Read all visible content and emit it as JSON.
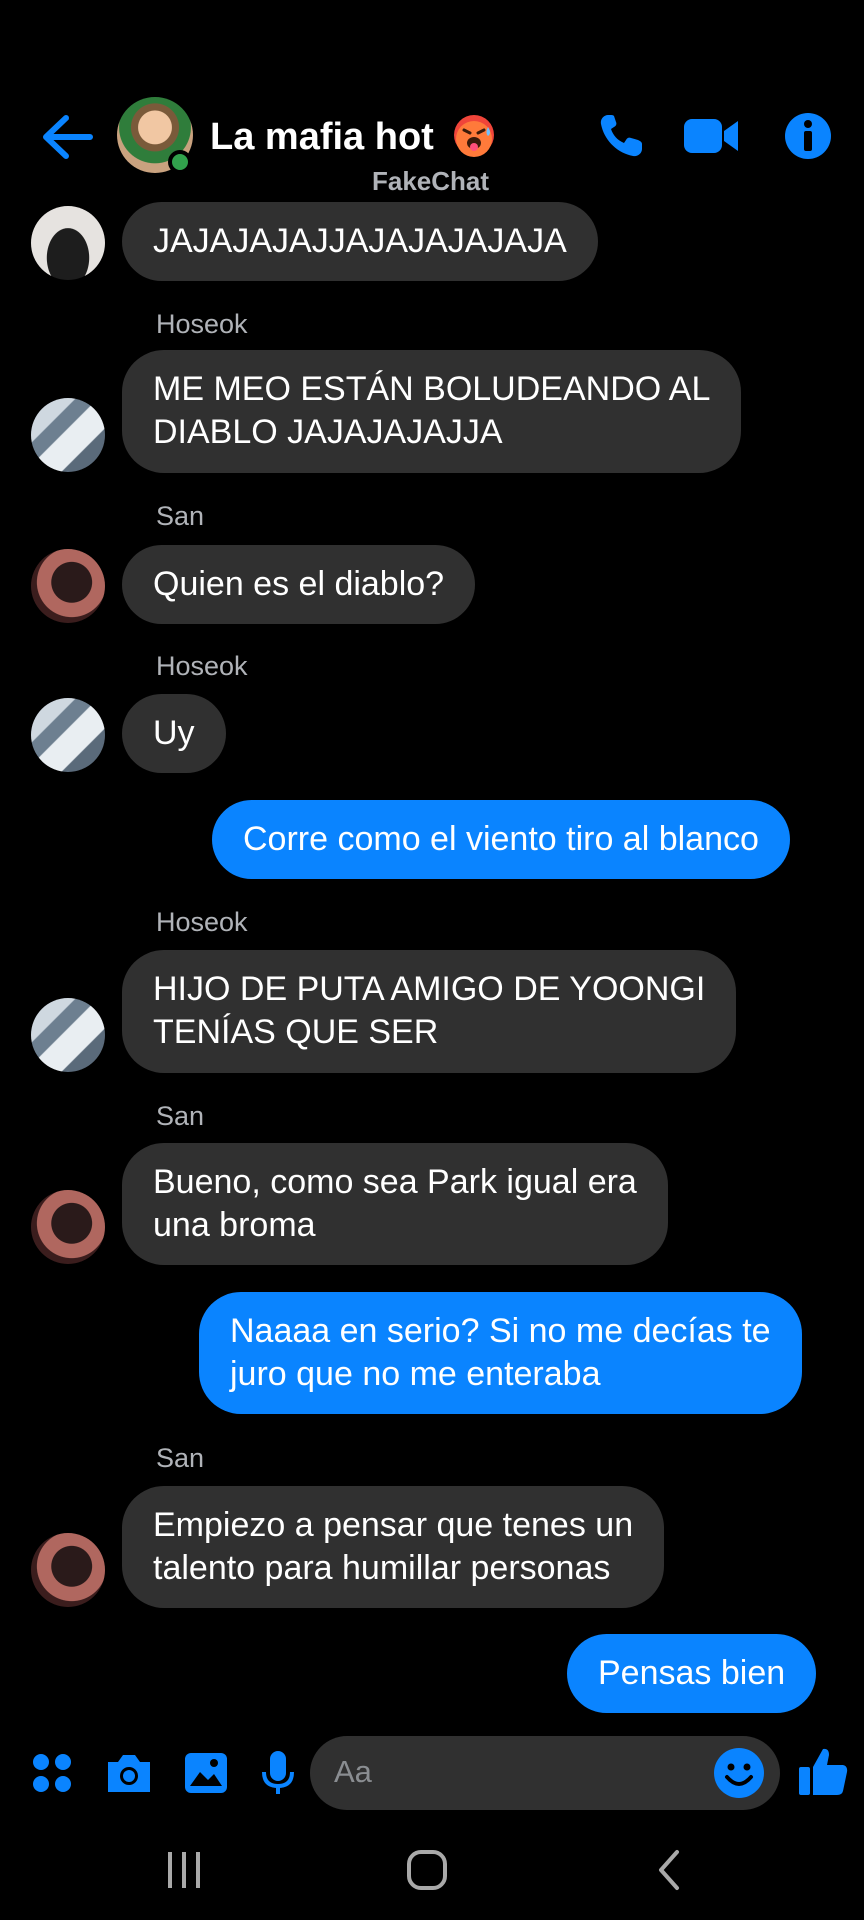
{
  "header": {
    "title": "La mafia hot",
    "subtitle": "FakeChat",
    "icons": [
      "back-arrow-icon",
      "phone-icon",
      "video-camera-icon",
      "info-icon"
    ]
  },
  "messages": [
    {
      "side": "in",
      "text": "JAJAJAJAJJAJAJAJAJAJA"
    },
    {
      "side": "in",
      "sender": "Hoseok",
      "text": "ME MEO ESTÁN BOLUDEANDO AL\nDIABLO JAJAJAJAJJA"
    },
    {
      "side": "in",
      "sender": "San",
      "text": "Quien es el diablo?"
    },
    {
      "side": "in",
      "sender": "Hoseok",
      "text": "Uy"
    },
    {
      "side": "out",
      "text": "Corre como el viento tiro al blanco"
    },
    {
      "side": "in",
      "sender": "Hoseok",
      "text": "HIJO DE PUTA AMIGO DE YOONGI\nTENÍAS QUE SER"
    },
    {
      "side": "in",
      "sender": "San",
      "text": "Bueno, como sea Park igual era\nuna broma"
    },
    {
      "side": "out",
      "text": "Naaaa en serio? Si no me decías te\njuro que no me enteraba"
    },
    {
      "side": "in",
      "sender": "San",
      "text": "Empiezo a pensar que tenes un\ntalento para humillar personas"
    },
    {
      "side": "out",
      "text": "Pensas bien"
    }
  ],
  "composer": {
    "placeholder": "Aa",
    "icons": [
      "apps-icon",
      "camera-icon",
      "gallery-icon",
      "microphone-icon",
      "emoji-icon",
      "thumbs-up-icon"
    ]
  },
  "colors": {
    "accent": "#0a84ff",
    "bubble_in": "#303030",
    "background": "#000000",
    "online": "#31a24c"
  }
}
